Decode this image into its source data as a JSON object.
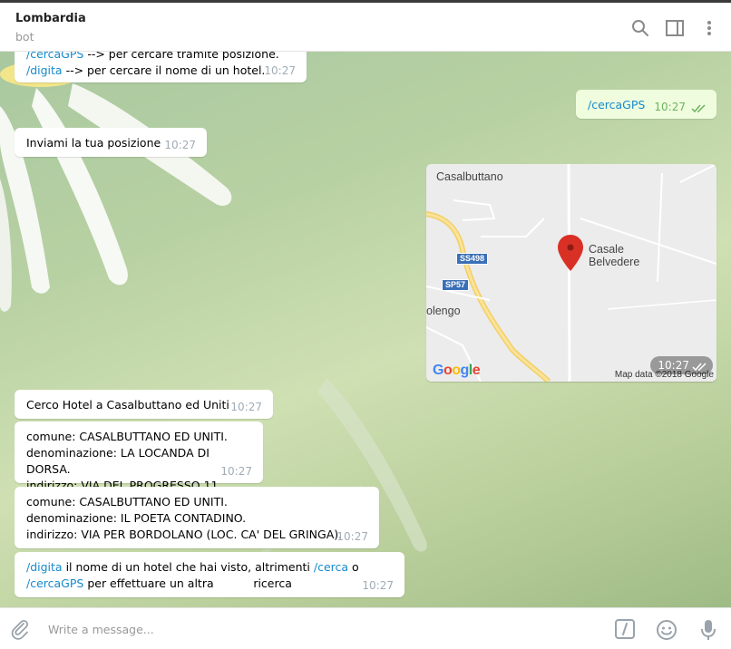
{
  "header": {
    "title": "Lombardia",
    "status": "bot",
    "icons": [
      "search-icon",
      "sidebar-toggle-icon",
      "more-vertical-icon"
    ]
  },
  "messages": {
    "m1": {
      "line1_cmd": "/cercaGPS",
      "line1_text": "  --> per cercare tramite posizione.",
      "line2_cmd": "/digita",
      "line2_text": "  --> per cercare il nome di un hotel.",
      "time": "10:27"
    },
    "m2": {
      "cmd": "/cercaGPS",
      "time": "10:27"
    },
    "m3": {
      "text": "Inviami la tua posizione",
      "time": "10:27"
    },
    "map": {
      "labels": {
        "town1": "Casalbuttano",
        "place_line1": "Casale",
        "place_line2": "Belvedere",
        "town2": "olengo",
        "shield1": "SS498",
        "shield2": "SP57"
      },
      "google": [
        "G",
        "o",
        "o",
        "g",
        "l",
        "e"
      ],
      "google_colors": [
        "#4285f4",
        "#ea4335",
        "#fbbc05",
        "#4285f4",
        "#34a853",
        "#ea4335"
      ],
      "data_text": "Map data ©2018 Google",
      "time": "10:27"
    },
    "m4": {
      "text": "Cerco Hotel a Casalbuttano ed Uniti",
      "time": "10:27"
    },
    "m5": {
      "line1": "comune: CASALBUTTANO ED UNITI.",
      "line2": "denominazione: LA LOCANDA DI DORSA.",
      "line3": "indirizzo: VIA DEL PROGRESSO 11.",
      "time": "10:27"
    },
    "m6": {
      "line1": "comune: CASALBUTTANO ED UNITI.",
      "line2": "denominazione: IL POETA CONTADINO.",
      "line3": "indirizzo: VIA PER BORDOLANO (LOC. CA' DEL GRINGA).",
      "time": "10:27"
    },
    "m7": {
      "cmd1": "/digita",
      "text1": " il nome di un hotel che hai visto, altrimenti ",
      "cmd2": "/cerca",
      "text2": " o",
      "cmd3": "/cercaGPS",
      "text3": " per effettuare un altra           ricerca",
      "time": "10:27"
    }
  },
  "composer": {
    "placeholder": "Write a message...",
    "icons": [
      "paperclip-icon",
      "bot-command-icon",
      "emoji-icon",
      "microphone-icon"
    ]
  },
  "colors": {
    "link": "#168acd",
    "outgoing_bubble": "#effdde",
    "read_ticks": "#6cb35f",
    "time_gray": "#a0acb6",
    "map_pin": "#d93025"
  }
}
